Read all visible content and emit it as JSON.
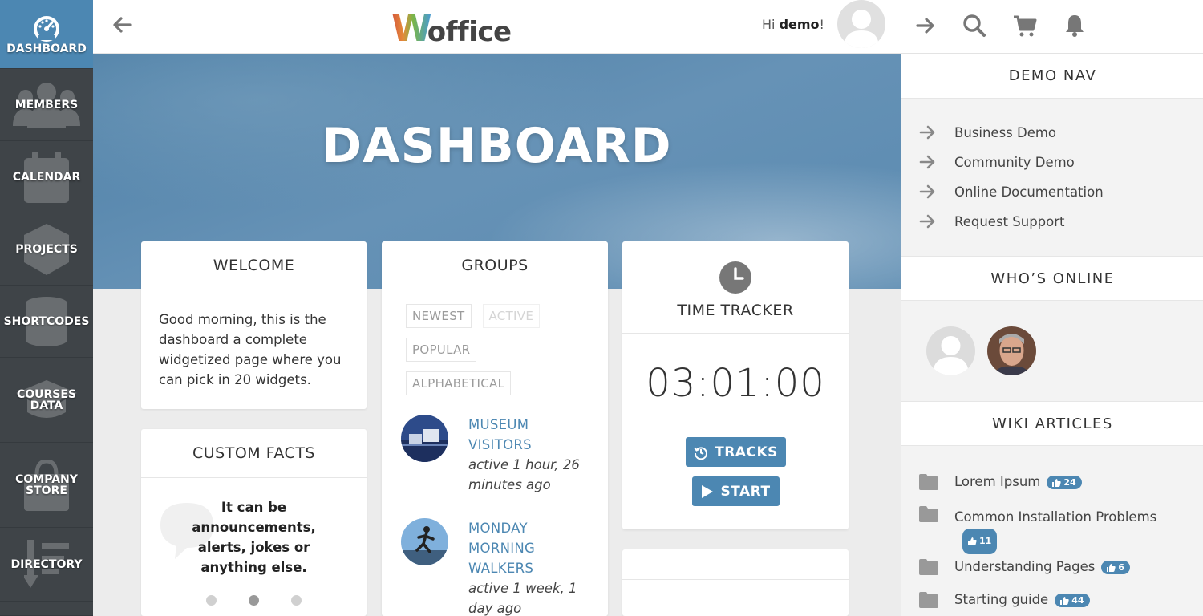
{
  "sidebar": {
    "items": [
      {
        "label": "DASHBOARD",
        "icon": "dashboard-gauge-icon",
        "active": true
      },
      {
        "label": "MEMBERS",
        "icon": "members-icon"
      },
      {
        "label": "CALENDAR",
        "icon": "calendar-icon"
      },
      {
        "label": "PROJECTS",
        "icon": "projects-cube-icon"
      },
      {
        "label": "SHORTCODES",
        "icon": "database-icon"
      },
      {
        "label": "COURSES DATA",
        "icon": "graduation-cap-icon"
      },
      {
        "label": "COMPANY STORE",
        "icon": "shopping-bag-icon"
      },
      {
        "label": "DIRECTORY",
        "icon": "directory-list-icon"
      }
    ]
  },
  "header": {
    "logo_w": "W",
    "logo_rest": "office",
    "greeting_prefix": "Hi ",
    "greeting_user": "demo",
    "greeting_suffix": "!"
  },
  "hero": {
    "title": "DASHBOARD"
  },
  "welcome": {
    "title": "WELCOME",
    "body": "Good morning, this is the dashboard a complete widgetized page where you can pick in 20 widgets."
  },
  "custom_facts": {
    "title": "CUSTOM FACTS",
    "body": "It can be announcements, alerts, jokes or anything else."
  },
  "groups": {
    "title": "GROUPS",
    "filters": [
      "NEWEST",
      "ACTIVE",
      "POPULAR",
      "ALPHABETICAL"
    ],
    "items": [
      {
        "name": "MUSEUM VISITORS",
        "time": "active 1 hour, 26 minutes ago"
      },
      {
        "name": "MONDAY MORNING WALKERS",
        "time": "active 1 week, 1 day ago"
      }
    ]
  },
  "time_tracker": {
    "title": "TIME TRACKER",
    "time": "03:01:00",
    "tracks_label": "TRACKS",
    "start_label": "START"
  },
  "right_panel": {
    "demo_nav_title": "DEMO NAV",
    "demo_nav": [
      "Business Demo",
      "Community Demo",
      "Online Documentation",
      "Request Support"
    ],
    "whos_online_title": "WHO’S ONLINE",
    "wiki_title": "WIKI ARTICLES",
    "wiki": [
      {
        "title": "Lorem Ipsum",
        "likes": "24"
      },
      {
        "title": "Common Installation Problems",
        "likes": "11"
      },
      {
        "title": "Understanding Pages",
        "likes": "6"
      },
      {
        "title": "Starting guide",
        "likes": "44"
      }
    ]
  },
  "colors": {
    "accent": "#4c87b2",
    "sidebar": "#3f4448"
  }
}
